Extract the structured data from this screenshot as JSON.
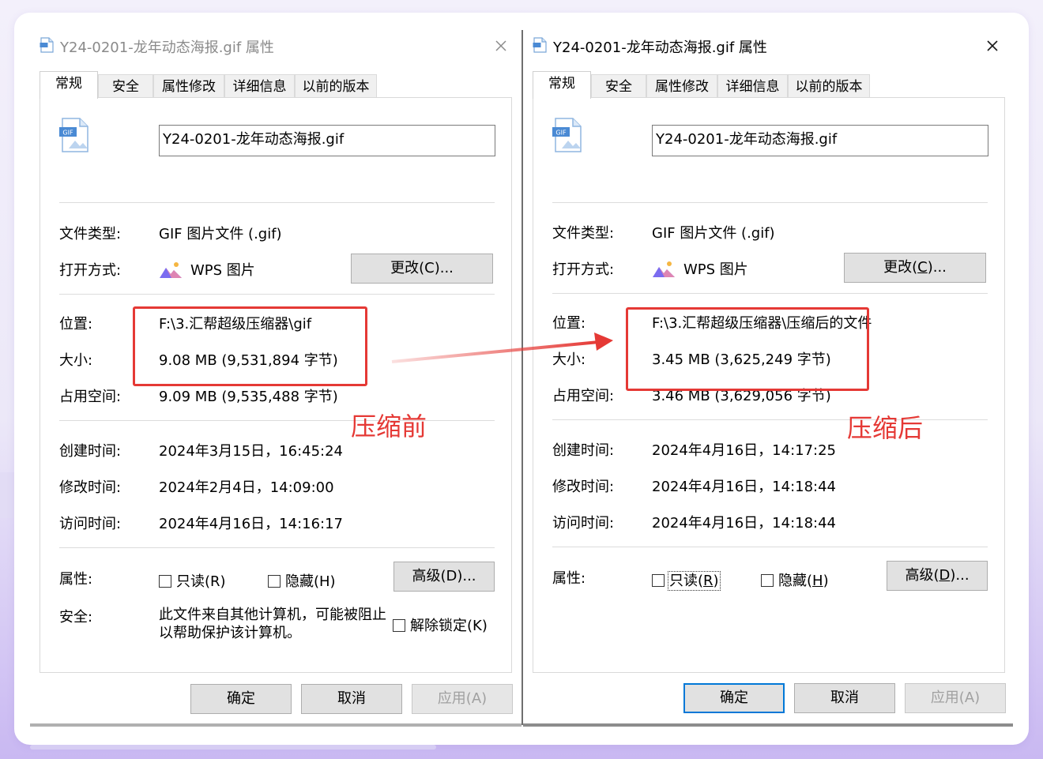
{
  "left": {
    "title": "Y24-0201-龙年动态海报.gif 属性",
    "tabs": [
      "常规",
      "安全",
      "属性修改",
      "详细信息",
      "以前的版本"
    ],
    "filename": "Y24-0201-龙年动态海报.gif",
    "file_type_label": "文件类型:",
    "file_type": "GIF 图片文件 (.gif)",
    "open_with_label": "打开方式:",
    "open_with": "WPS 图片",
    "change_button": "更改(C)...",
    "location_label": "位置:",
    "location": "F:\\3.汇帮超级压缩器\\gif",
    "size_label": "大小:",
    "size": "9.08 MB (9,531,894 字节)",
    "disk_label": "占用空间:",
    "disk": "9.09 MB (9,535,488 字节)",
    "created_label": "创建时间:",
    "created": "2024年3月15日，16:45:24",
    "modified_label": "修改时间:",
    "modified": "2024年2月4日，14:09:00",
    "accessed_label": "访问时间:",
    "accessed": "2024年4月16日，14:16:17",
    "attributes_label": "属性:",
    "readonly": "只读(R)",
    "hidden": "隐藏(H)",
    "advanced_button": "高级(D)...",
    "security_label": "安全:",
    "security_text": "此文件来自其他计算机，可能被阻止以帮助保护该计算机。",
    "unblock": "解除锁定(K)",
    "ok": "确定",
    "cancel": "取消",
    "apply": "应用(A)",
    "annotation": "压缩前"
  },
  "right": {
    "title": "Y24-0201-龙年动态海报.gif 属性",
    "tabs": [
      "常规",
      "安全",
      "属性修改",
      "详细信息",
      "以前的版本"
    ],
    "filename": "Y24-0201-龙年动态海报.gif",
    "file_type_label": "文件类型:",
    "file_type": "GIF 图片文件 (.gif)",
    "open_with_label": "打开方式:",
    "open_with": "WPS 图片",
    "change_button_prefix": "更改(",
    "change_button_key": "C",
    "change_button_suffix": ")...",
    "location_label": "位置:",
    "location": "F:\\3.汇帮超级压缩器\\压缩后的文件",
    "size_label": "大小:",
    "size": "3.45 MB (3,625,249 字节)",
    "disk_label": "占用空间:",
    "disk": "3.46 MB (3,629,056 字节)",
    "created_label": "创建时间:",
    "created": "2024年4月16日，14:17:25",
    "modified_label": "修改时间:",
    "modified": "2024年4月16日，14:18:44",
    "accessed_label": "访问时间:",
    "accessed": "2024年4月16日，14:18:44",
    "attributes_label": "属性:",
    "readonly_prefix": "只读(",
    "readonly_key": "R",
    "readonly_suffix": ")",
    "hidden_prefix": "隐藏(",
    "hidden_key": "H",
    "hidden_suffix": ")",
    "advanced_prefix": "高级(",
    "advanced_key": "D",
    "advanced_suffix": ")...",
    "ok": "确定",
    "cancel": "取消",
    "apply": "应用(A)",
    "annotation": "压缩后"
  },
  "icons": {
    "file_icon_badge": "GIF",
    "close": "close-icon",
    "wps": "wps-picture-icon",
    "file": "gif-file-icon"
  },
  "colors": {
    "highlight": "#e53935",
    "focus": "#0078d7"
  }
}
